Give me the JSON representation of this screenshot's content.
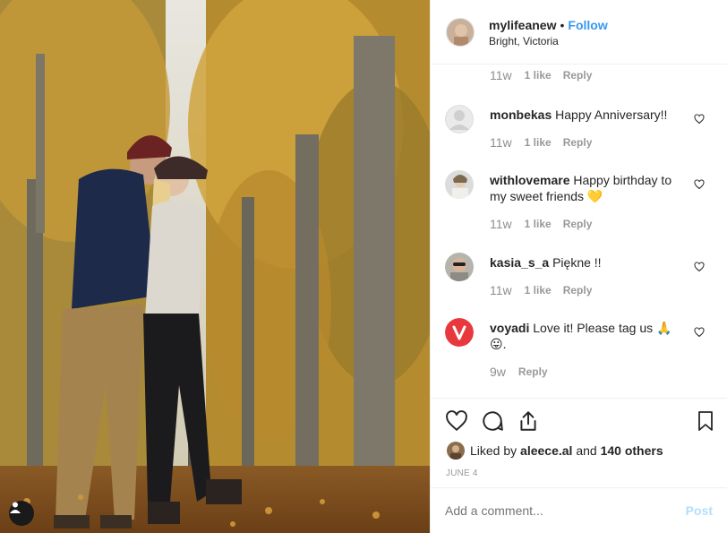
{
  "post": {
    "username": "mylifeanew",
    "separator": "•",
    "follow_label": "Follow",
    "location": "Bright, Victoria"
  },
  "comments": [
    {
      "meta": {
        "time": "11w",
        "likes": "1 like",
        "reply": "Reply"
      }
    },
    {
      "username": "monbekas",
      "text": "Happy Anniversary!!",
      "meta": {
        "time": "11w",
        "likes": "1 like",
        "reply": "Reply"
      }
    },
    {
      "username": "withlovemare",
      "text": "Happy birthday to my sweet friends 💛",
      "meta": {
        "time": "11w",
        "likes": "1 like",
        "reply": "Reply"
      }
    },
    {
      "username": "kasia_s_a",
      "text": "Piękne !!",
      "meta": {
        "time": "11w",
        "likes": "1 like",
        "reply": "Reply"
      }
    },
    {
      "username": "voyadi",
      "text": "Love it! Please tag us 🙏 😛.",
      "meta": {
        "time": "9w",
        "reply": "Reply"
      }
    }
  ],
  "likes": {
    "prefix": "Liked by",
    "user": "aleece.al",
    "mid": "and",
    "others": "140 others"
  },
  "date": "JUNE 4",
  "add_comment": {
    "placeholder": "Add a comment...",
    "post_label": "Post"
  },
  "colors": {
    "link": "#3897f0",
    "post_disabled": "#b2dffc",
    "voyadi_brand": "#e8383d"
  },
  "icons": [
    "heart-icon",
    "comment-icon",
    "share-icon",
    "bookmark-icon",
    "user-tag-icon"
  ]
}
